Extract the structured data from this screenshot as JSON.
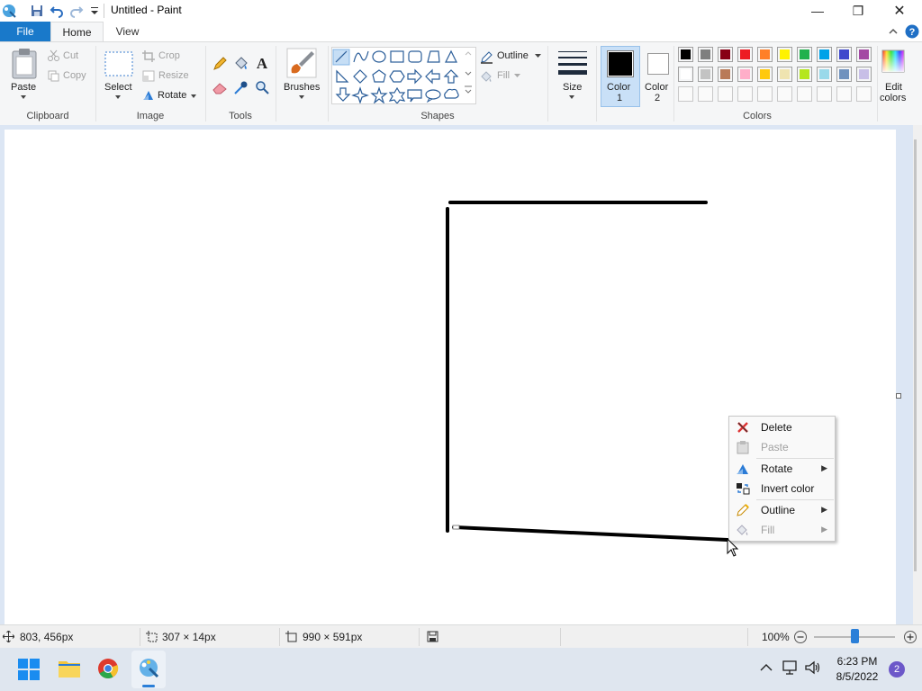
{
  "window": {
    "title": "Untitled - Paint",
    "controls": {
      "minimize": "—",
      "maximize": "❐",
      "close": "✕"
    }
  },
  "tabs": {
    "file": "File",
    "home": "Home",
    "view": "View"
  },
  "ribbon": {
    "clipboard": {
      "paste": "Paste",
      "cut": "Cut",
      "copy": "Copy",
      "group": "Clipboard"
    },
    "image": {
      "select": "Select",
      "crop": "Crop",
      "resize": "Resize",
      "rotate": "Rotate",
      "group": "Image"
    },
    "tools": {
      "group": "Tools",
      "text_glyph": "A"
    },
    "brushes": {
      "label": "Brushes"
    },
    "shapes": {
      "outline": "Outline",
      "fill": "Fill",
      "group": "Shapes"
    },
    "size": {
      "label": "Size"
    },
    "color1": {
      "line1": "Color",
      "line2": "1",
      "value": "#000000"
    },
    "color2": {
      "line1": "Color",
      "line2": "2",
      "value": "#ffffff"
    },
    "colors": {
      "group": "Colors",
      "row1": [
        "#000000",
        "#7f7f7f",
        "#880015",
        "#ed1c24",
        "#ff7f27",
        "#fff200",
        "#22b14c",
        "#00a2e8",
        "#3f48cc",
        "#a349a4"
      ],
      "row2": [
        "#ffffff",
        "#c3c3c3",
        "#b97a57",
        "#ffaec9",
        "#ffc90e",
        "#efe4b0",
        "#b5e61d",
        "#99d9ea",
        "#7092be",
        "#c8bfe7"
      ],
      "row3": [
        "",
        "",
        "",
        "",
        "",
        "",
        "",
        "",
        "",
        ""
      ]
    },
    "edit_colors": {
      "line1": "Edit",
      "line2": "colors"
    }
  },
  "context_menu": {
    "items": [
      {
        "label": "Delete",
        "enabled": true,
        "submenu": false
      },
      {
        "label": "Paste",
        "enabled": false,
        "submenu": false
      },
      {
        "label": "Rotate",
        "enabled": true,
        "submenu": true
      },
      {
        "label": "Invert color",
        "enabled": true,
        "submenu": false
      },
      {
        "label": "Outline",
        "enabled": true,
        "submenu": true
      },
      {
        "label": "Fill",
        "enabled": false,
        "submenu": true
      }
    ]
  },
  "status": {
    "cursor_pos": "803, 456px",
    "selection_size": "307 × 14px",
    "canvas_size": "990 × 591px",
    "zoom": "100%",
    "zoom_level": 0.5
  },
  "taskbar": {
    "time": "6:23 PM",
    "date": "8/5/2022",
    "notifications": "2"
  }
}
